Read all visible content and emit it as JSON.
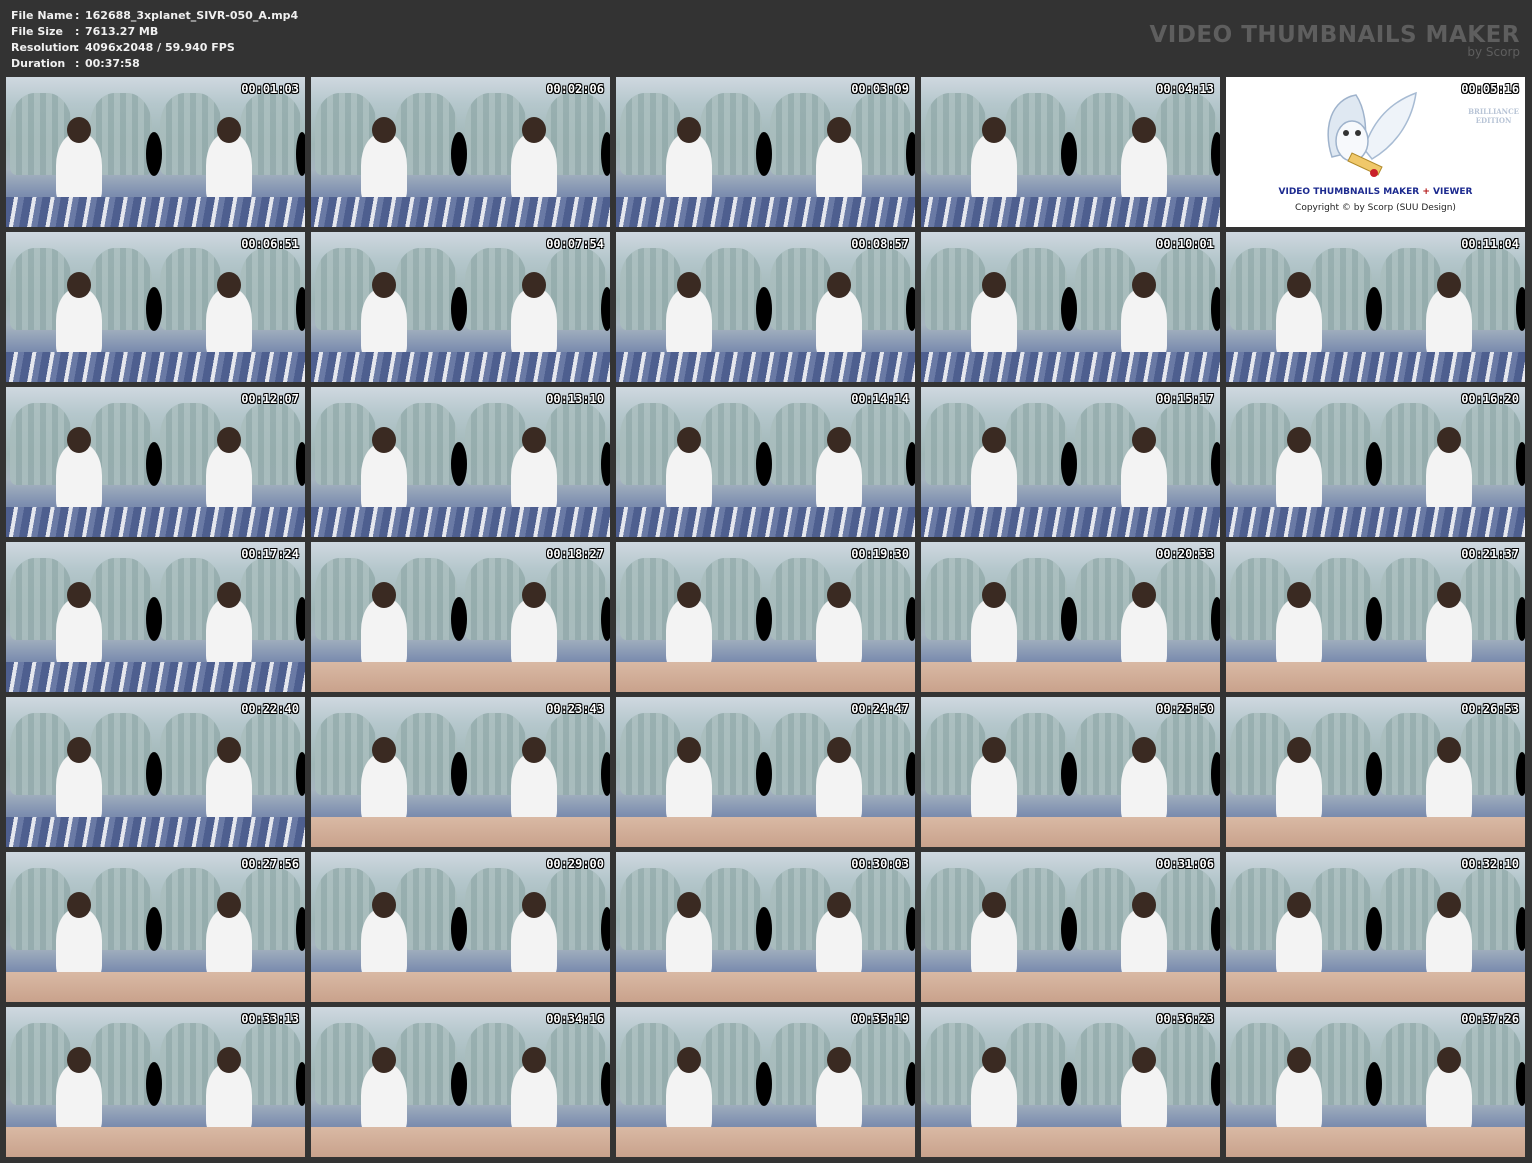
{
  "file_info": {
    "rows": [
      {
        "label": "File Name",
        "sep": ":",
        "value": "162688_3xplanet_SIVR-050_A.mp4"
      },
      {
        "label": "File Size",
        "sep": ":",
        "value": "7613.27 MB"
      },
      {
        "label": "Resolution",
        "sep": ":",
        "value": "4096x2048 / 59.940 FPS"
      },
      {
        "label": "Duration",
        "sep": ":",
        "value": "00:37:58"
      }
    ]
  },
  "brand": {
    "title": "VIDEO THUMBNAILS MAKER",
    "subtitle": "by Scorp"
  },
  "logo_tile": {
    "edition_line1": "BRILLIANCE",
    "edition_line2": "EDITION",
    "title_part1": "VIDEO THUMBNAILS MAKER",
    "title_plus": "+",
    "title_part2": "VIEWER",
    "copyright": "Copyright © by Scorp (SUU Design)"
  },
  "thumbnails": [
    {
      "time": "00:01:03"
    },
    {
      "time": "00:02:06"
    },
    {
      "time": "00:03:09"
    },
    {
      "time": "00:04:13"
    },
    {
      "time": "00:05:16"
    },
    {
      "time": "00:06:51"
    },
    {
      "time": "00:07:54"
    },
    {
      "time": "00:08:57"
    },
    {
      "time": "00:10:01"
    },
    {
      "time": "00:11:04"
    },
    {
      "time": "00:12:07"
    },
    {
      "time": "00:13:10"
    },
    {
      "time": "00:14:14"
    },
    {
      "time": "00:15:17"
    },
    {
      "time": "00:16:20"
    },
    {
      "time": "00:17:24"
    },
    {
      "time": "00:18:27"
    },
    {
      "time": "00:19:30"
    },
    {
      "time": "00:20:33"
    },
    {
      "time": "00:21:37"
    },
    {
      "time": "00:22:40"
    },
    {
      "time": "00:23:43"
    },
    {
      "time": "00:24:47"
    },
    {
      "time": "00:25:50"
    },
    {
      "time": "00:26:53"
    },
    {
      "time": "00:27:56"
    },
    {
      "time": "00:29:00"
    },
    {
      "time": "00:30:03"
    },
    {
      "time": "00:31:06"
    },
    {
      "time": "00:32:10"
    },
    {
      "time": "00:33:13"
    },
    {
      "time": "00:34:16"
    },
    {
      "time": "00:35:19"
    },
    {
      "time": "00:36:23"
    },
    {
      "time": "00:37:26"
    }
  ]
}
